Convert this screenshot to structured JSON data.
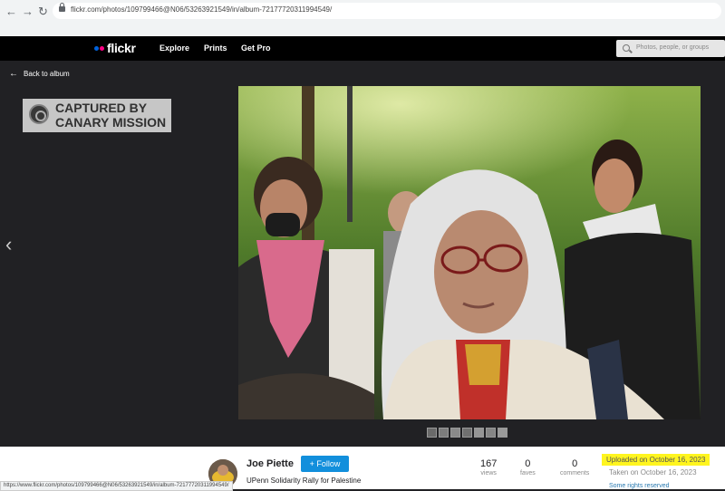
{
  "browser": {
    "url": "flickr.com/photos/109799466@N06/53263921549/in/album-72177720311994549/",
    "back_icon": "arrow-left",
    "forward_icon": "arrow-right",
    "reload_icon": "reload"
  },
  "header": {
    "logo_text": "flickr",
    "logo_colors": [
      "#0063dc",
      "#ff0084"
    ],
    "nav": [
      "Explore",
      "Prints",
      "Get Pro"
    ],
    "search_placeholder": "Photos, people, or groups"
  },
  "viewer": {
    "back_label": "Back to album",
    "watermark_lines": [
      "CAPTURED BY",
      "CANARY MISSION"
    ],
    "prev_icon": "chevron-left",
    "thumbnail_count": 7
  },
  "info": {
    "owner": "Joe Piette",
    "follow_label": "+ Follow",
    "photo_title": "UPenn Solidarity Rally for Palestine",
    "stats": [
      {
        "value": "167",
        "label": "views"
      },
      {
        "value": "0",
        "label": "faves"
      },
      {
        "value": "0",
        "label": "comments"
      }
    ],
    "uploaded": "Uploaded on October 16, 2023",
    "taken": "Taken on October 16, 2023",
    "license": "Some rights reserved",
    "highlight_color": "#fff51f"
  },
  "status_bar_url": "https://www.flickr.com/photos/109799466@N06/53263921549/in/album-72177720311994549/"
}
